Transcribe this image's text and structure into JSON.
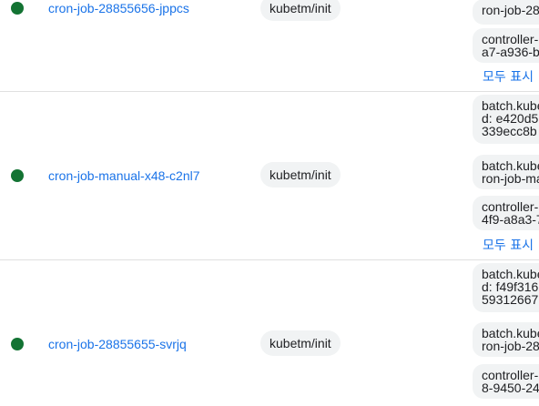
{
  "colors": {
    "status_ok": "#137333",
    "link": "#1a73e8",
    "chip_bg": "#f1f3f4",
    "divider": "#e0e0e0"
  },
  "show_all_label": "모두 표시",
  "rows": [
    {
      "status": "running",
      "pod_name": "cron-job-28855656-jppcs",
      "namespace": "kubetm/init",
      "labels": [
        "ron-job-28",
        "controller-\na7-a936-b"
      ]
    },
    {
      "status": "running",
      "pod_name": "cron-job-manual-x48-c2nl7",
      "namespace": "kubetm/init",
      "labels": [
        "batch.kube\nd: e420d5\n339ecc8b",
        "batch.kube\nron-job-ma",
        "controller-\n4f9-a8a3-7"
      ]
    },
    {
      "status": "running",
      "pod_name": "cron-job-28855655-svrjq",
      "namespace": "kubetm/init",
      "labels": [
        "batch.kube\nd: f49f316\n59312667",
        "batch.kube\nron-job-28",
        "controller-\n8-9450-24"
      ]
    }
  ]
}
